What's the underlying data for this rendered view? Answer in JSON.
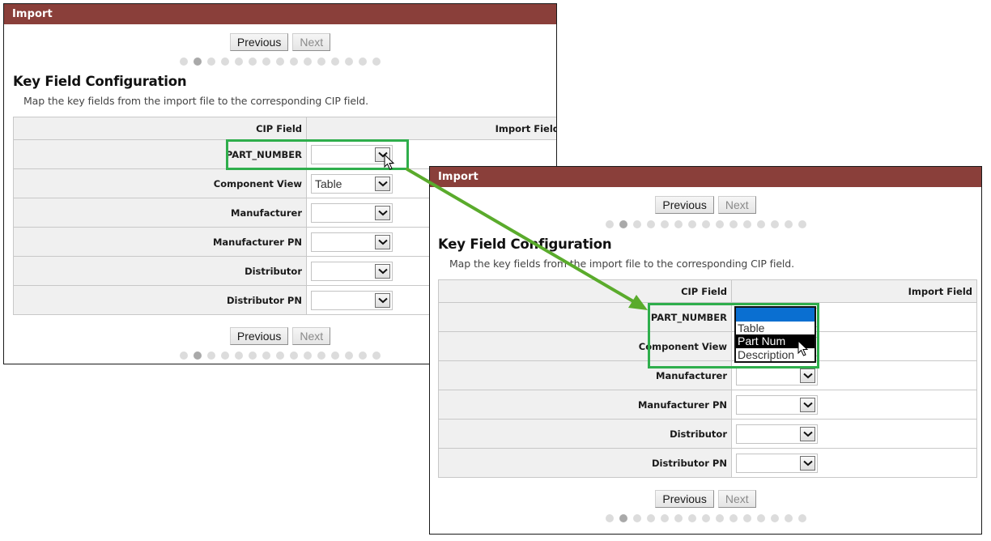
{
  "window_title": "Import",
  "nav": {
    "previous_label": "Previous",
    "next_label": "Next",
    "next_disabled": true,
    "step_count": 15,
    "current_step": 2
  },
  "section": {
    "title": "Key Field Configuration",
    "subtitle": "Map the key fields from the import file to the corresponding CIP field."
  },
  "table": {
    "headers": {
      "cip_field": "CIP Field",
      "import_field": "Import Field"
    },
    "rows": [
      {
        "cip_field": "PART_NUMBER",
        "import_value": ""
      },
      {
        "cip_field": "Component View",
        "import_value": "Table"
      },
      {
        "cip_field": "Manufacturer",
        "import_value": ""
      },
      {
        "cip_field": "Manufacturer PN",
        "import_value": ""
      },
      {
        "cip_field": "Distributor",
        "import_value": ""
      },
      {
        "cip_field": "Distributor PN",
        "import_value": ""
      }
    ]
  },
  "dropdown": {
    "field": "PART_NUMBER",
    "options": [
      "",
      "Table",
      "Part Num",
      "Description"
    ],
    "selected_index": 0,
    "hover_index": 2
  },
  "colors": {
    "titlebar": "#8a3f3a",
    "highlight": "#2fae4c",
    "arrow": "#5aab2c",
    "selected_option": "#0a6fd1"
  },
  "icons": {
    "select_arrow": "chevron-down-icon",
    "pointer": "mouse-pointer-icon",
    "annotation_arrow": "arrow-icon"
  }
}
